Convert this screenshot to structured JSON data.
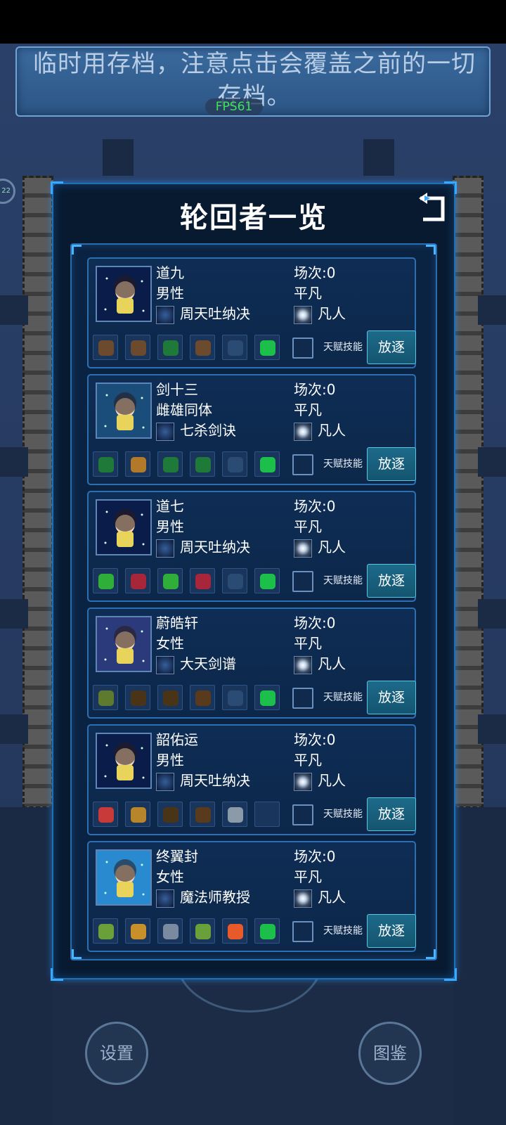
{
  "notice": {
    "text": "临时用存档，注意点击会覆盖之前的一切存档。",
    "fps": "FPS61"
  },
  "dialog": {
    "title": "轮回者一览",
    "back_icon": "return-arrow-icon",
    "cards": [
      {
        "name": "道九",
        "gender": "男性",
        "skill": "周天吐纳决",
        "rounds": "场次:0",
        "rank": "平凡",
        "realm": "凡人",
        "talent_label": "天赋技能",
        "exile_label": "放逐",
        "items": [
          "#6b4a2e",
          "#6b4a2e",
          "#1f7a3a",
          "#6b4a2e",
          "#2a4b74",
          "#1bbf4a"
        ],
        "avatar_color": "#0a1c4a"
      },
      {
        "name": "剑十三",
        "gender": "雌雄同体",
        "skill": "七杀剑诀",
        "rounds": "场次:0",
        "rank": "平凡",
        "realm": "凡人",
        "talent_label": "天赋技能",
        "exile_label": "放逐",
        "items": [
          "#1f7a3a",
          "#b07a2a",
          "#1f7a3a",
          "#1f7a3a",
          "#2a4b74",
          "#1bbf4a"
        ],
        "avatar_color": "#1a4d7a"
      },
      {
        "name": "道七",
        "gender": "男性",
        "skill": "周天吐纳决",
        "rounds": "场次:0",
        "rank": "平凡",
        "realm": "凡人",
        "talent_label": "天赋技能",
        "exile_label": "放逐",
        "items": [
          "#2fae3a",
          "#a8263a",
          "#2fae3a",
          "#a8263a",
          "#2a4b74",
          "#1bbf4a"
        ],
        "avatar_color": "#0a1c4a"
      },
      {
        "name": "蔚皓轩",
        "gender": "女性",
        "skill": "大天剑谱",
        "rounds": "场次:0",
        "rank": "平凡",
        "realm": "凡人",
        "talent_label": "天赋技能",
        "exile_label": "放逐",
        "items": [
          "#5d7a2e",
          "#4a3418",
          "#4a3418",
          "#5a3a1c",
          "#2a4b74",
          "#1bbf4a"
        ],
        "avatar_color": "#2a3a7a"
      },
      {
        "name": "韶佑运",
        "gender": "男性",
        "skill": "周天吐纳决",
        "rounds": "场次:0",
        "rank": "平凡",
        "realm": "凡人",
        "talent_label": "天赋技能",
        "exile_label": "放逐",
        "items": [
          "#c83a3a",
          "#b8862a",
          "#4a3418",
          "#5a3a1c",
          "#8a9aa8",
          "#1a355c"
        ],
        "avatar_color": "#0a1c4a"
      },
      {
        "name": "终翼封",
        "gender": "女性",
        "skill": "魔法师教授",
        "rounds": "场次:0",
        "rank": "平凡",
        "realm": "凡人",
        "talent_label": "天赋技能",
        "exile_label": "放逐",
        "items": [
          "#6aa03a",
          "#c8902a",
          "#7a8aa0",
          "#6aa03a",
          "#e85a2a",
          "#1bbf4a"
        ],
        "avatar_color": "#2a8ad0"
      }
    ]
  },
  "bottom": {
    "settings_label": "设置",
    "codex_label": "图鉴"
  },
  "left_badge": "22"
}
